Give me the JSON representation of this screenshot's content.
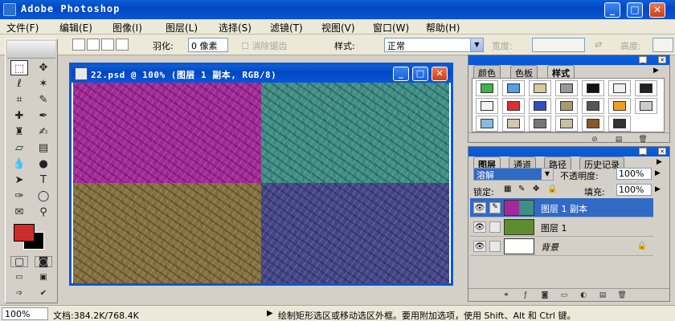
{
  "window": {
    "title": "Adobe Photoshop",
    "minimize": "_",
    "maximize": "□",
    "close": "✕"
  },
  "menu": [
    "文件(F)",
    "编辑(E)",
    "图像(I)",
    "图层(L)",
    "选择(S)",
    "滤镜(T)",
    "视图(V)",
    "窗口(W)",
    "帮助(H)"
  ],
  "options": {
    "feather_label": "羽化:",
    "feather_value": "0 像素",
    "antialias_label": "消除锯齿",
    "style_label": "样式:",
    "style_value": "正常",
    "width_label": "宽度:",
    "height_label": "高度:"
  },
  "document": {
    "title": "22.psd @ 100% (图层 1 副本, RGB/8)",
    "minimize": "_",
    "maximize": "□",
    "close": "✕",
    "quad_colors": [
      "#a42a9a",
      "#3f8f86",
      "#86723f",
      "#46478a"
    ]
  },
  "styles_panel": {
    "tabs": [
      "颜色",
      "色板",
      "样式"
    ],
    "active_tab": 2,
    "swatch_colors": [
      "#3fb24a",
      "#5a9ee0",
      "#d8c89a",
      "#999999",
      "#111111",
      "#eeeeee",
      "#222222",
      "#f4f4f4",
      "#d93030",
      "#3050c0",
      "#a89c6a",
      "#555555",
      "#f0a020",
      "#cccccc",
      "#8ab8e0",
      "#d0c8b0",
      "#777777",
      "#c8c0a0",
      "#8a5a20",
      "#333333"
    ]
  },
  "layers_panel": {
    "tabs": [
      "图层",
      "通道",
      "路径",
      "历史记录"
    ],
    "active_tab": 0,
    "blend_mode": "溶解",
    "opacity_label": "不透明度:",
    "opacity_value": "100%",
    "lock_label": "锁定:",
    "fill_label": "填充:",
    "fill_value": "100%",
    "layers": [
      {
        "name": "图层 1 副本",
        "selected": true
      },
      {
        "name": "图层 1",
        "selected": false
      },
      {
        "name": "背景",
        "selected": false,
        "locked": true
      }
    ]
  },
  "status": {
    "zoom": "100%",
    "docinfo": "文档:384.2K/768.4K",
    "arrow": "▶",
    "hint": "绘制矩形选区或移动选区外框。要用附加选项，使用 Shift、Alt 和 Ctrl 键。"
  }
}
